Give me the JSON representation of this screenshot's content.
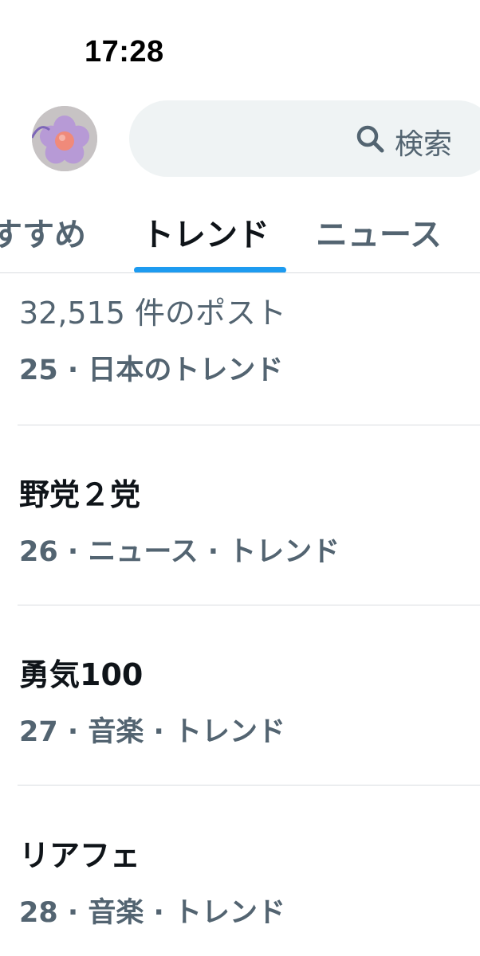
{
  "status_bar": {
    "time": "17:28"
  },
  "header": {
    "avatar": {
      "icon": "flower-avatar",
      "petal_color": "#b79ad6",
      "center_color": "#f08a7a"
    },
    "search": {
      "placeholder": "検索",
      "icon": "search-icon"
    }
  },
  "tabs": [
    {
      "label": "すすめ",
      "active": false
    },
    {
      "label": "トレンド",
      "active": true
    },
    {
      "label": "ニュース",
      "active": false
    }
  ],
  "accent_color": "#1d9bf0",
  "trends": [
    {
      "post_count": "32,515 件のポスト",
      "meta": "25 · 日本のトレンド"
    },
    {
      "title": "野党２党",
      "meta": "26 · ニュース · トレンド"
    },
    {
      "title": "勇気100",
      "meta": "27 · 音楽 · トレンド"
    },
    {
      "title": "リアフェ",
      "meta": "28 · 音楽 · トレンド"
    }
  ]
}
